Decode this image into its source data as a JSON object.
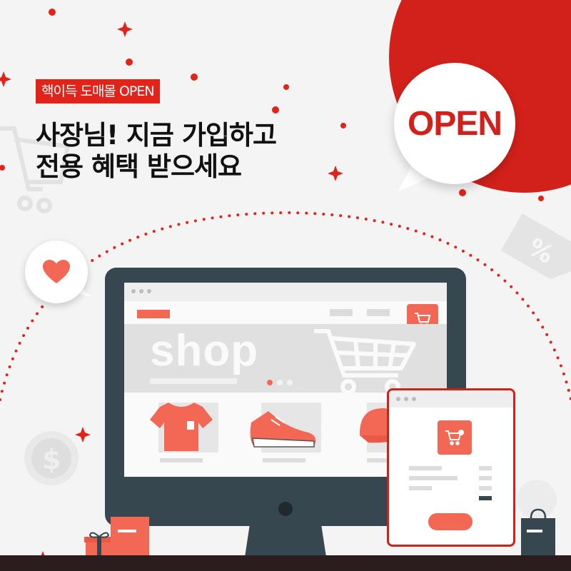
{
  "promo": {
    "tag": "핵이득 도매몰 OPEN",
    "headline_line1": "사장님! 지금 가입하고",
    "headline_line2": "전용 혜택 받으세요",
    "bubble_text": "OPEN"
  },
  "screen": {
    "hero_text": "shop",
    "products": [
      "t-shirt",
      "sneaker",
      "cap"
    ]
  },
  "colors": {
    "brand_red": "#d2211a",
    "accent_coral": "#f26855",
    "monitor_dark": "#37474f",
    "background": "#f4f4f4",
    "ground": "#2b1d1d"
  },
  "icons": [
    "cart-icon",
    "heart-icon",
    "dollar-coin-icon",
    "percent-tag-icon",
    "sparkle-icon",
    "shopping-bag-icon",
    "gift-box-icon"
  ]
}
